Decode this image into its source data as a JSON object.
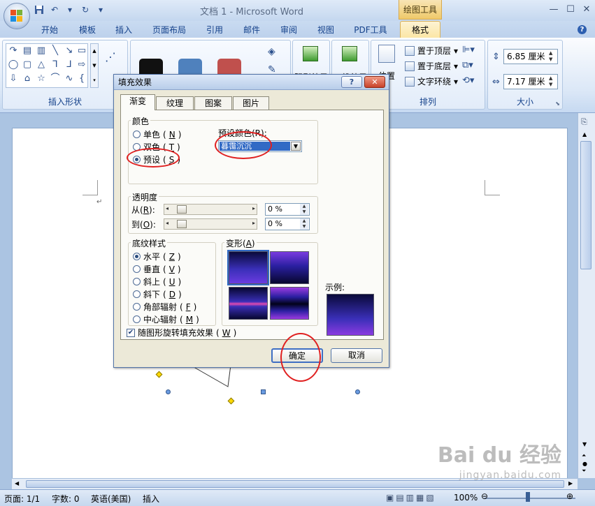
{
  "window": {
    "title": "文档 1 - Microsoft Word",
    "context_tool": "绘图工具",
    "minimize": "—",
    "maximize": "☐",
    "close": "✕"
  },
  "quick_access": {
    "save": "save-icon",
    "undo": "↶",
    "redo": "↻",
    "customize": "▾"
  },
  "ribbon_tabs": [
    {
      "label": "开始"
    },
    {
      "label": "模板"
    },
    {
      "label": "插入"
    },
    {
      "label": "页面布局"
    },
    {
      "label": "引用"
    },
    {
      "label": "邮件"
    },
    {
      "label": "审阅"
    },
    {
      "label": "视图"
    },
    {
      "label": "PDF工具"
    },
    {
      "label": "格式",
      "active": true
    }
  ],
  "help_label": "?",
  "ribbon": {
    "insert_shapes_label": "插入形状",
    "arrange_label": "排列",
    "size_label": "大小",
    "shadow_effect_label": "阴影效果",
    "threed_effect_label": "三维效果",
    "position_label": "位置",
    "bring_front": "置于顶层",
    "send_back": "置于底层",
    "text_wrap": "文字环绕",
    "height_value": "6.85 厘米",
    "width_value": "7.17 厘米",
    "style_colors": [
      "#111111",
      "#4f81bd",
      "#c0504d"
    ]
  },
  "dialog": {
    "title": "填充效果",
    "help": "?",
    "close": "✕",
    "tabs": [
      {
        "label": "渐变",
        "active": true
      },
      {
        "label": "纹理"
      },
      {
        "label": "图案"
      },
      {
        "label": "图片"
      }
    ],
    "color_group": "颜色",
    "color_options": [
      {
        "label": "单色",
        "key": "N",
        "selected": false
      },
      {
        "label": "双色",
        "key": "T",
        "selected": false
      },
      {
        "label": "预设",
        "key": "S",
        "selected": true
      }
    ],
    "preset_label": "预设颜色(R):",
    "preset_value": "暮霭沉沉",
    "transparency_group": "透明度",
    "from_label": "从",
    "from_key": "R",
    "from_value": "0 %",
    "to_label": "到",
    "to_key": "O",
    "to_value": "0 %",
    "shading_group": "底纹样式",
    "shading_options": [
      {
        "label": "水平",
        "key": "Z",
        "selected": true
      },
      {
        "label": "垂直",
        "key": "V",
        "selected": false
      },
      {
        "label": "斜上",
        "key": "U",
        "selected": false
      },
      {
        "label": "斜下",
        "key": "D",
        "selected": false
      },
      {
        "label": "角部辐射",
        "key": "F",
        "selected": false
      },
      {
        "label": "中心辐射",
        "key": "M",
        "selected": false
      }
    ],
    "variants_label": "变形",
    "variants_key": "A",
    "sample_label": "示例:",
    "rotate_checkbox": "随图形旋转填充效果",
    "rotate_key": "W",
    "rotate_checked": true,
    "ok": "确定",
    "cancel": "取消"
  },
  "document": {
    "paragraph_mark": "↵"
  },
  "statusbar": {
    "page": "页面: 1/1",
    "words": "字数: 0",
    "language": "英语(美国)",
    "insert_mode": "插入",
    "zoom": "100%"
  },
  "watermark": {
    "main": "Bai du 经验",
    "sub": "jingyan.baidu.com"
  }
}
